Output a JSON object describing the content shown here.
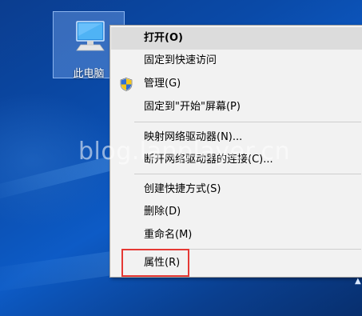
{
  "desktop": {
    "icon_label": "此电脑",
    "icon_name": "computer-monitor-icon",
    "watermark": "blog.lanplayer.cn"
  },
  "context_menu": {
    "items": [
      {
        "label": "打开(O)",
        "bold": true,
        "highlighted": true
      },
      {
        "label": "固定到快速访问"
      },
      {
        "label": "管理(G)",
        "icon": "uac-shield-icon"
      },
      {
        "label": "固定到\"开始\"屏幕(P)"
      },
      {
        "label": "映射网络驱动器(N)..."
      },
      {
        "label": "断开网络驱动器的连接(C)..."
      },
      {
        "label": "创建快捷方式(S)"
      },
      {
        "label": "删除(D)"
      },
      {
        "label": "重命名(M)"
      },
      {
        "label": "属性(R)",
        "annotated": true
      }
    ]
  },
  "colors": {
    "menu_bg": "#f2f2f2",
    "highlight": "#dcdcdc",
    "annotation_red": "#e53935",
    "desktop_blue": "#0a4aa8"
  }
}
